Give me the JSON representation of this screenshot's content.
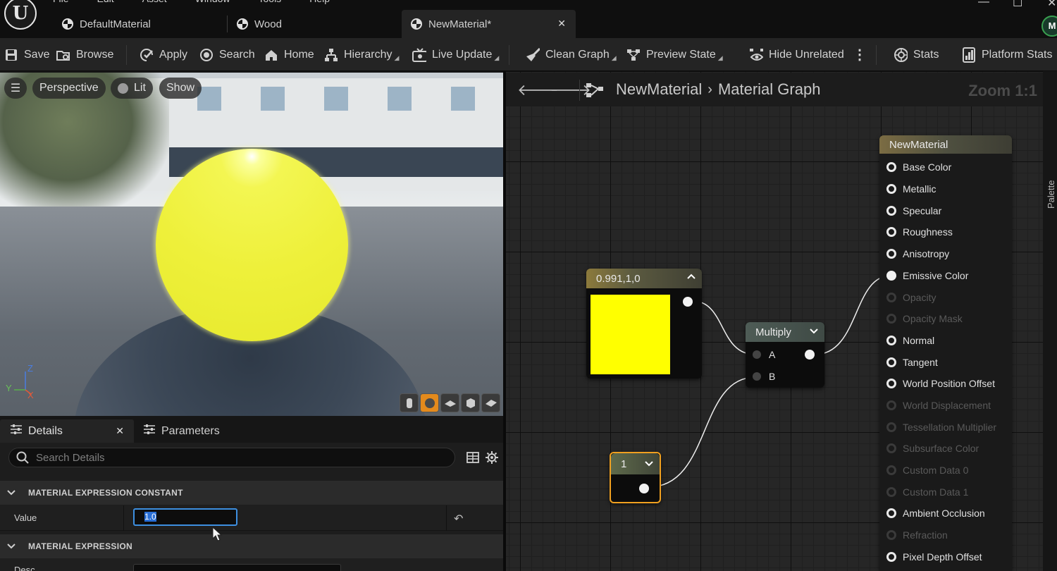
{
  "menu": [
    "File",
    "Edit",
    "Asset",
    "Window",
    "Tools",
    "Help"
  ],
  "tabs": [
    {
      "label": "DefaultMaterial"
    },
    {
      "label": "Wood"
    },
    {
      "label": "NewMaterial*"
    }
  ],
  "avatar_initial": "M",
  "toolbar": {
    "save": "Save",
    "browse": "Browse",
    "apply": "Apply",
    "search": "Search",
    "home": "Home",
    "hierarchy": "Hierarchy",
    "live_update": "Live Update",
    "clean_graph": "Clean Graph",
    "preview_state": "Preview State",
    "hide_unrelated": "Hide Unrelated",
    "stats": "Stats",
    "platform_stats": "Platform Stats"
  },
  "viewport": {
    "perspective": "Perspective",
    "lit": "Lit",
    "show": "Show",
    "axis_z": "Z",
    "axis_y": "Y",
    "axis_x": "X"
  },
  "details": {
    "tab_details": "Details",
    "tab_parameters": "Parameters",
    "search_placeholder": "Search Details",
    "category1": "MATERIAL EXPRESSION CONSTANT",
    "value_label": "Value",
    "value": "1.0",
    "category2": "MATERIAL EXPRESSION",
    "desc_label": "Desc"
  },
  "graph": {
    "crumb_material": "NewMaterial",
    "crumb_graph": "Material Graph",
    "zoom": "Zoom 1:1",
    "palette": "Palette"
  },
  "nodes": {
    "color_const": {
      "title": "0.991,1,0",
      "color": "#ffff00"
    },
    "multiply": {
      "title": "Multiply",
      "input_a": "A",
      "input_b": "B"
    },
    "constant": {
      "title": "1"
    },
    "material": {
      "title": "NewMaterial",
      "inputs": [
        {
          "label": "Base Color",
          "enabled": true
        },
        {
          "label": "Metallic",
          "enabled": true
        },
        {
          "label": "Specular",
          "enabled": true
        },
        {
          "label": "Roughness",
          "enabled": true
        },
        {
          "label": "Anisotropy",
          "enabled": true
        },
        {
          "label": "Emissive Color",
          "enabled": true
        },
        {
          "label": "Opacity",
          "enabled": false
        },
        {
          "label": "Opacity Mask",
          "enabled": false
        },
        {
          "label": "Normal",
          "enabled": true
        },
        {
          "label": "Tangent",
          "enabled": true
        },
        {
          "label": "World Position Offset",
          "enabled": true
        },
        {
          "label": "World Displacement",
          "enabled": false
        },
        {
          "label": "Tessellation Multiplier",
          "enabled": false
        },
        {
          "label": "Subsurface Color",
          "enabled": false
        },
        {
          "label": "Custom Data 0",
          "enabled": false
        },
        {
          "label": "Custom Data 1",
          "enabled": false
        },
        {
          "label": "Ambient Occlusion",
          "enabled": true
        },
        {
          "label": "Refraction",
          "enabled": false
        },
        {
          "label": "Pixel Depth Offset",
          "enabled": true
        }
      ]
    }
  }
}
